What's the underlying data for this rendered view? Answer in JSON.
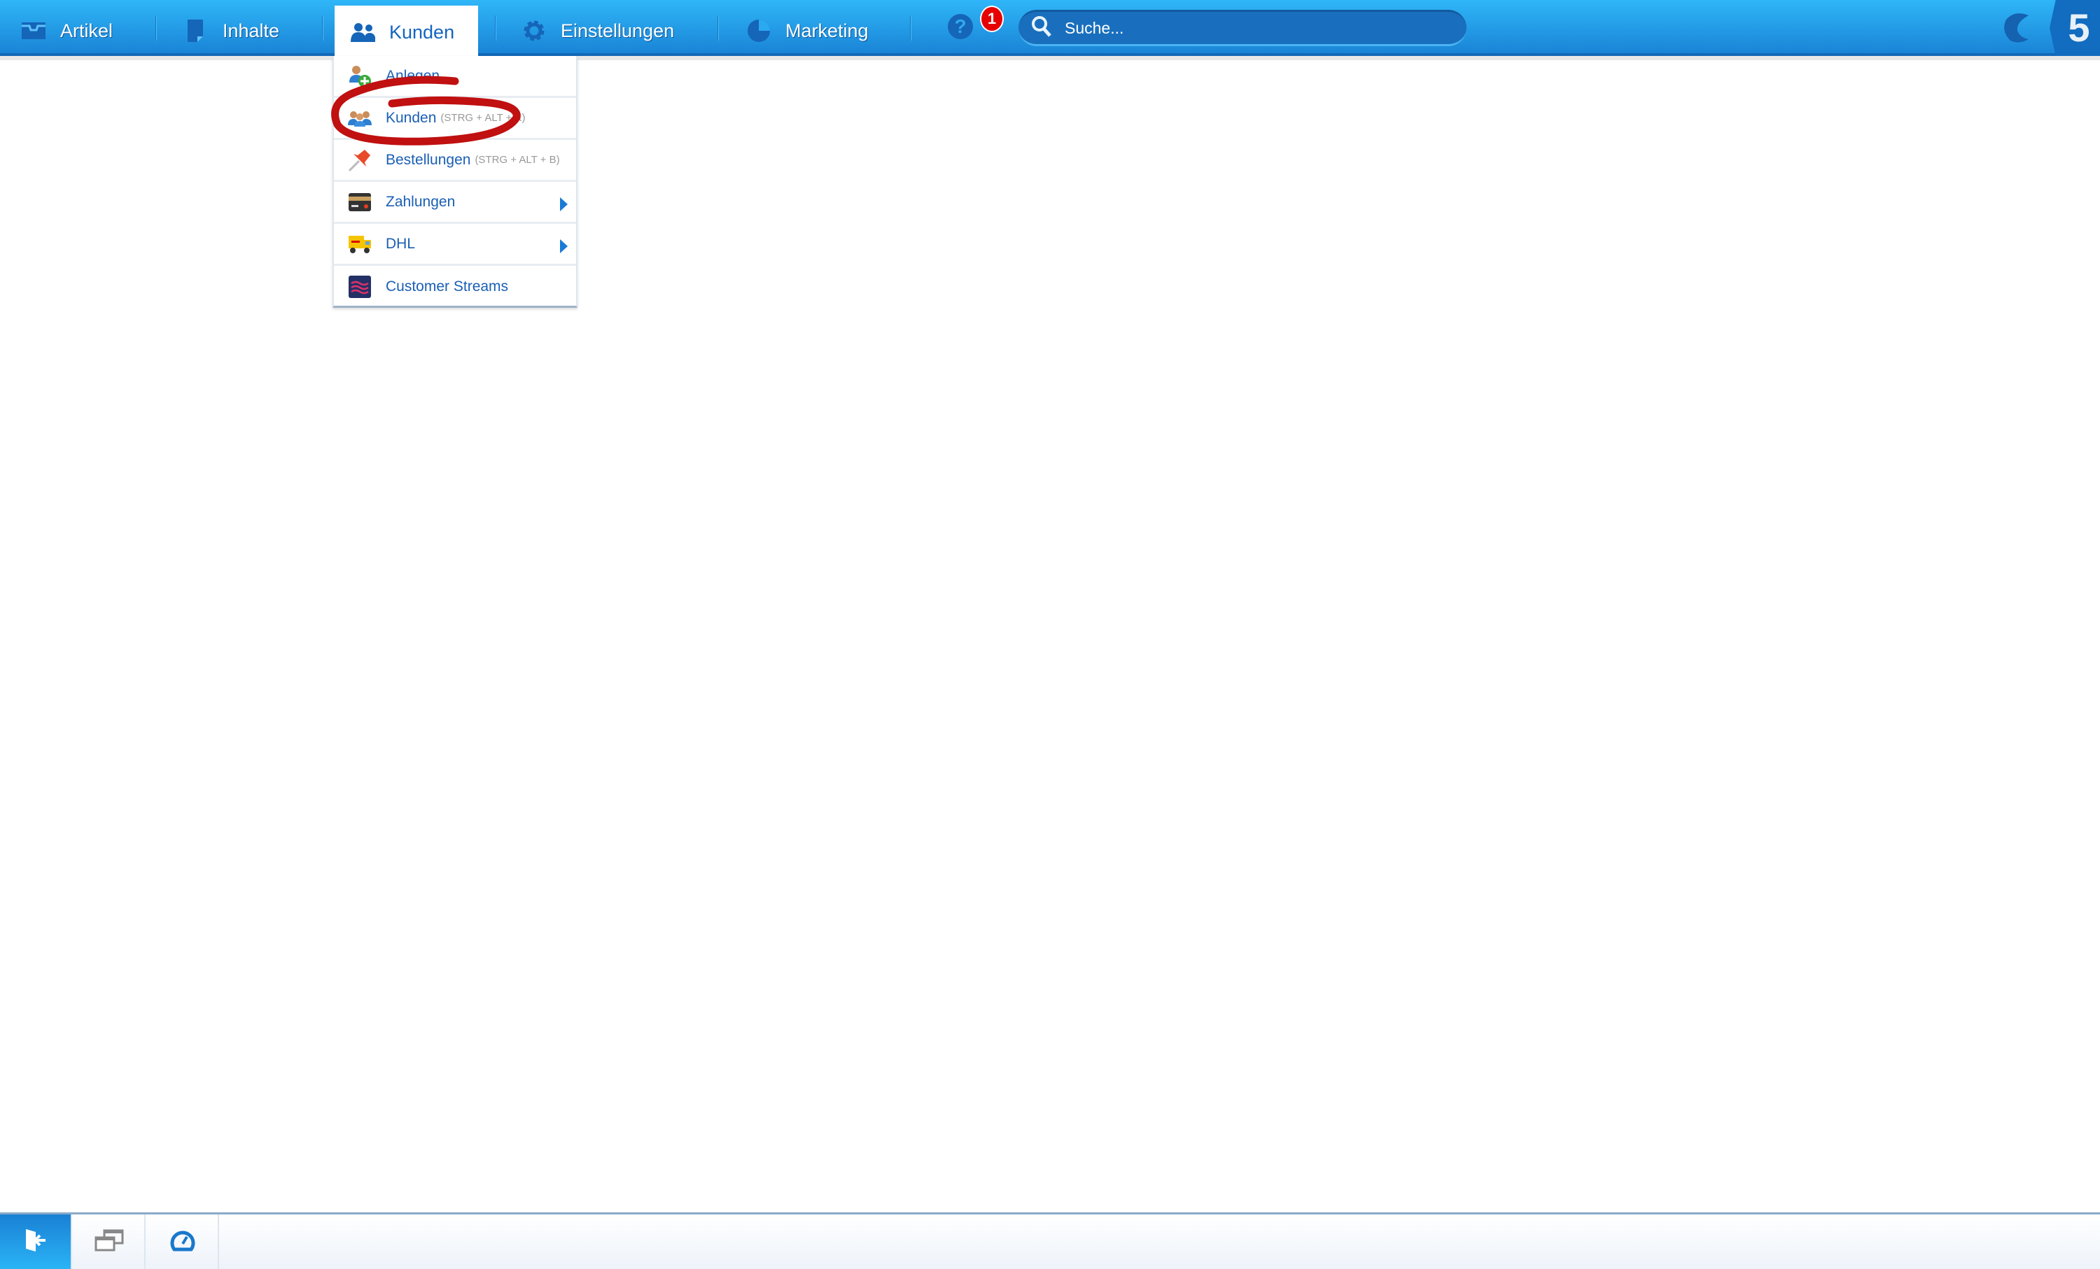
{
  "topnav": {
    "items": [
      {
        "label": "Artikel",
        "icon": "inbox-icon"
      },
      {
        "label": "Inhalte",
        "icon": "document-icon"
      },
      {
        "label": "Kunden",
        "icon": "users-icon",
        "active": true
      },
      {
        "label": "Einstellungen",
        "icon": "gear-icon"
      },
      {
        "label": "Marketing",
        "icon": "pie-chart-icon"
      }
    ],
    "help_icon": "?",
    "notification_count": "1",
    "search_placeholder": "Suche...",
    "logo_text": "5"
  },
  "dropdown": {
    "items": [
      {
        "label": "Anlegen",
        "shortcut": "",
        "icon": "user-add-icon"
      },
      {
        "label": "Kunden",
        "shortcut": "(STRG + ALT + K)",
        "icon": "users-group-icon"
      },
      {
        "label": "Bestellungen",
        "shortcut": "(STRG + ALT + B)",
        "icon": "pin-icon"
      },
      {
        "label": "Zahlungen",
        "shortcut": "",
        "icon": "credit-card-icon",
        "submenu": true
      },
      {
        "label": "DHL",
        "shortcut": "",
        "icon": "truck-icon",
        "submenu": true
      },
      {
        "label": "Customer Streams",
        "shortcut": "",
        "icon": "streams-icon"
      }
    ]
  },
  "annotation": {
    "color": "#c01010"
  },
  "colors": {
    "accent": "#1a84d6",
    "link": "#1a5fb4",
    "badge": "#e60000"
  }
}
